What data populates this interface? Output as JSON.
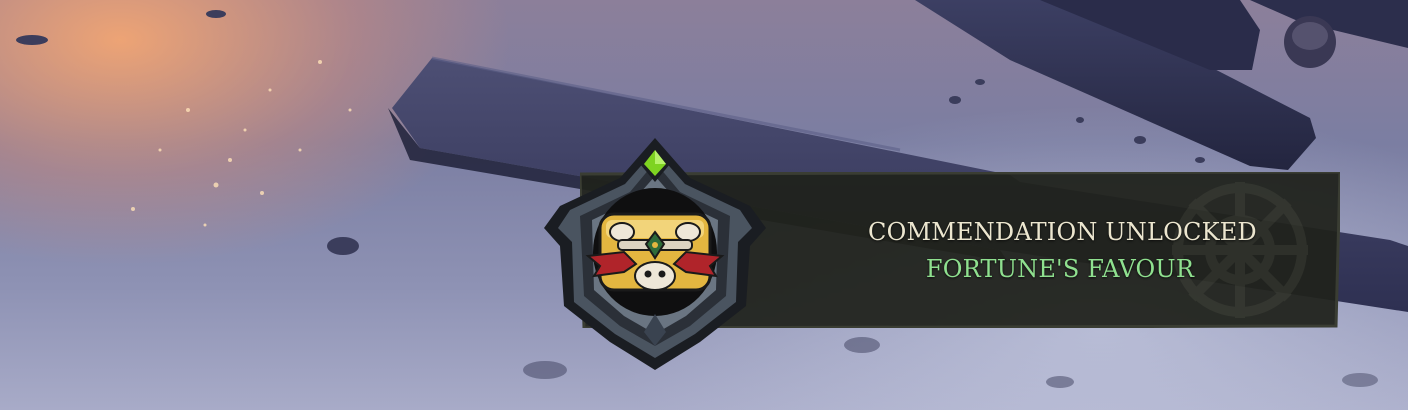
{
  "notification": {
    "heading": "COMMENDATION UNLOCKED",
    "name": "FORTUNE'S FAVOUR"
  },
  "colors": {
    "heading_text": "#ece6cf",
    "name_text": "#8fe08f",
    "banner_bg": "#20221c",
    "badge_frame": "#4a5460",
    "badge_gem": "#7ed321",
    "badge_gold": "#e3b640",
    "badge_ribbon": "#b0242a"
  },
  "icons": {
    "badge": "commendation-badge-icon",
    "gem": "diamond-gem-icon",
    "emblem": "skull-chest-emblem-icon"
  }
}
